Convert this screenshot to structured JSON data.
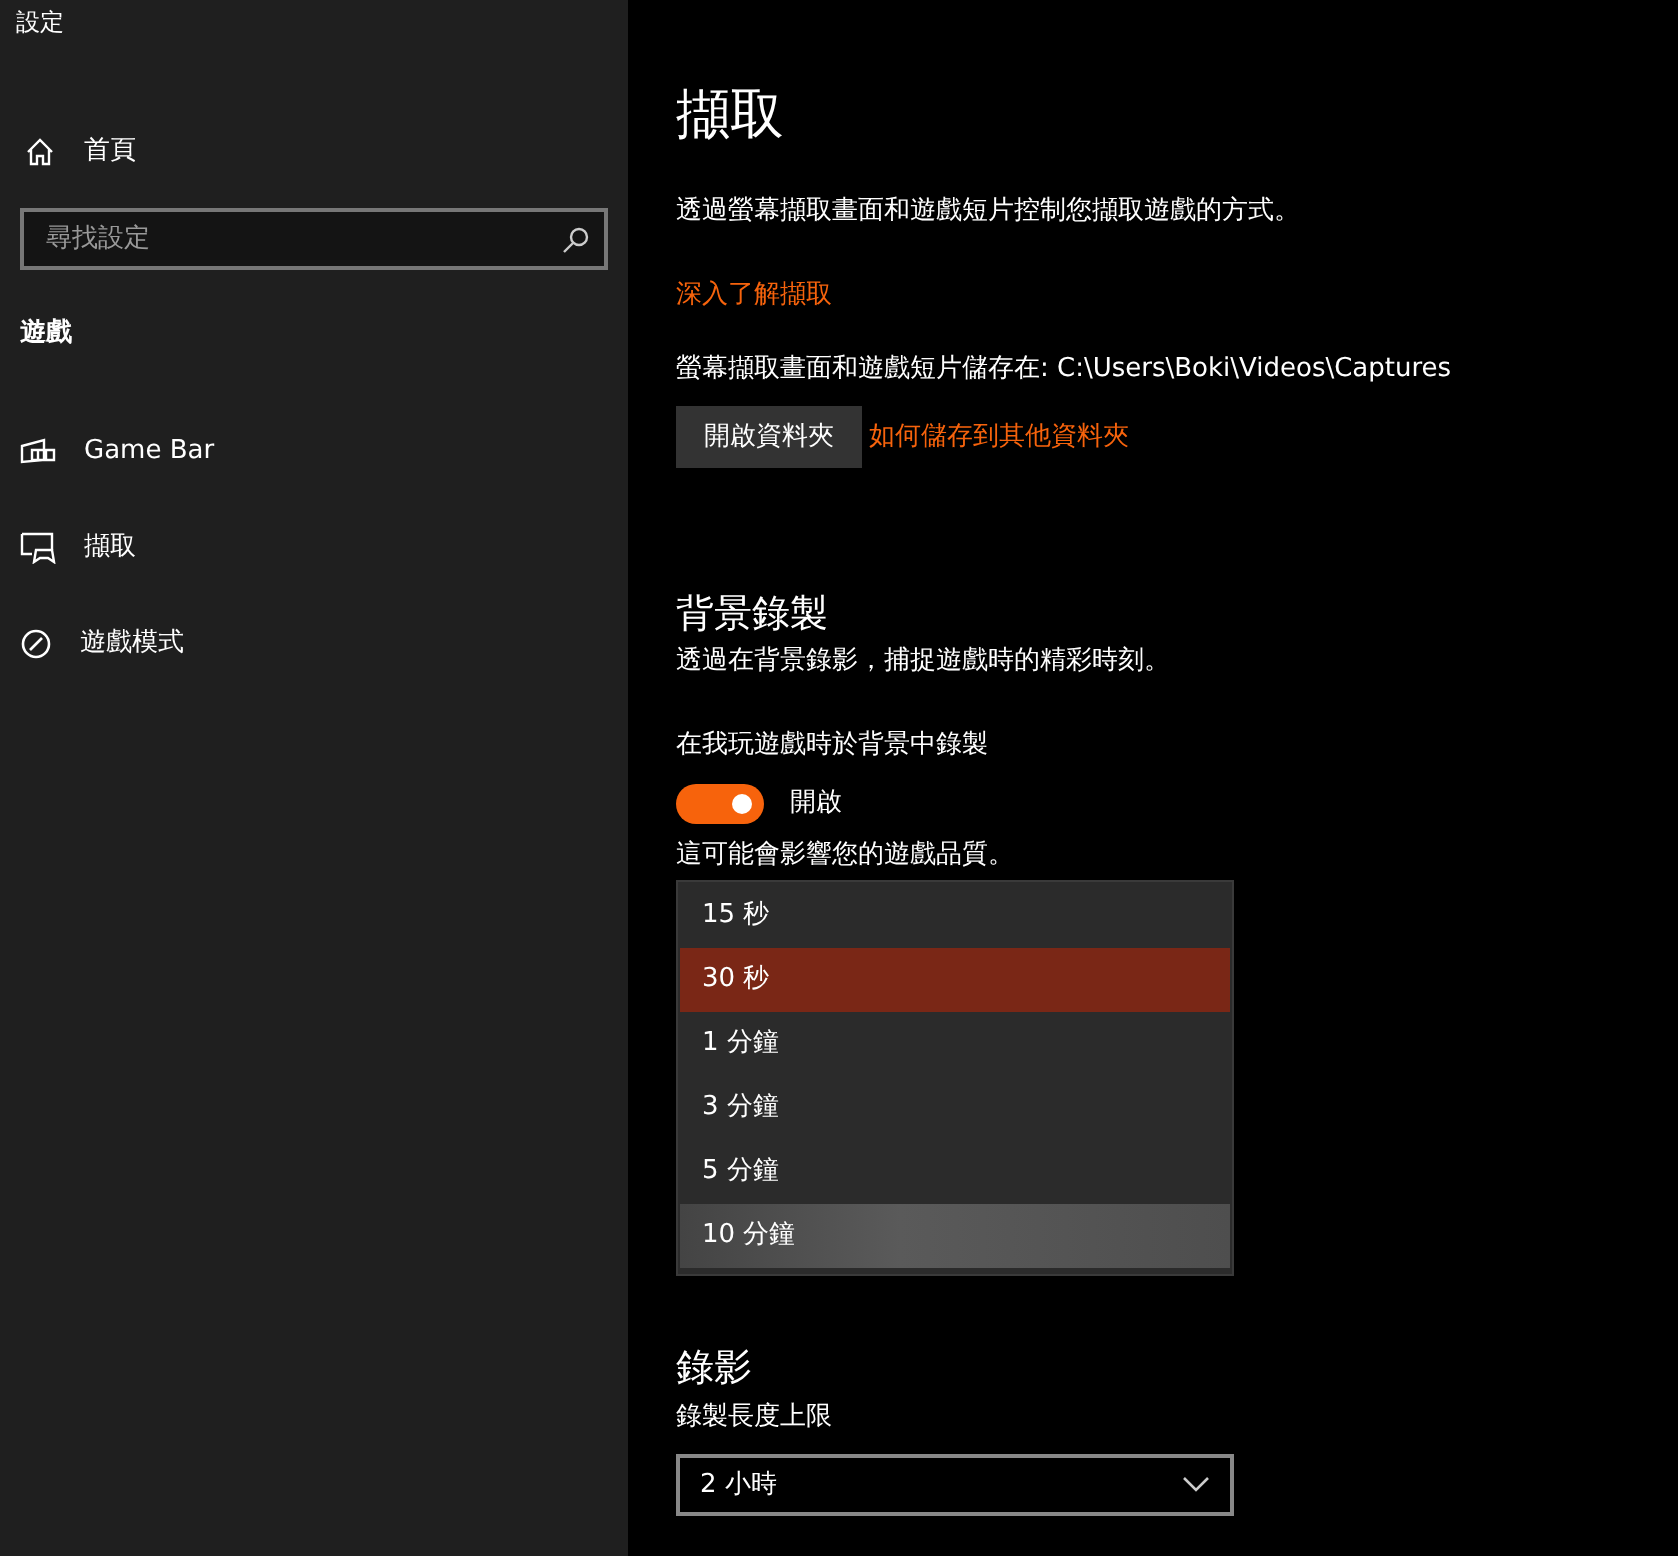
{
  "window": {
    "title": "設定"
  },
  "sidebar": {
    "home": "首頁",
    "search": {
      "placeholder": "尋找設定"
    },
    "section": "遊戲",
    "items": [
      {
        "label": "Game Bar",
        "kind": "gamebar"
      },
      {
        "label": "擷取",
        "kind": "capture"
      },
      {
        "label": "遊戲模式",
        "kind": "gamemode"
      }
    ]
  },
  "main": {
    "title": "擷取",
    "description": "透過螢幕擷取畫面和遊戲短片控制您擷取遊戲的方式。",
    "learn_more_link": "深入了解擷取",
    "save_path": "螢幕擷取畫面和遊戲短片儲存在: C:\\Users\\Boki\\Videos\\Captures",
    "open_folder_button": "開啟資料夾",
    "other_folder_link": "如何儲存到其他資料夾",
    "background_recording": {
      "heading": "背景錄製",
      "description": "透過在背景錄影，捕捉遊戲時的精彩時刻。",
      "toggle_label": "在我玩遊戲時於背景中錄製",
      "toggle": {
        "on": true,
        "state_text": "開啟"
      },
      "note": "這可能會影響您的遊戲品質。",
      "dropdown_options": [
        {
          "label": "15 秒",
          "selected": false,
          "hovered": false
        },
        {
          "label": "30 秒",
          "selected": true,
          "hovered": false
        },
        {
          "label": "1 分鐘",
          "selected": false,
          "hovered": false
        },
        {
          "label": "3 分鐘",
          "selected": false,
          "hovered": false
        },
        {
          "label": "5 分鐘",
          "selected": false,
          "hovered": false
        },
        {
          "label": "10 分鐘",
          "selected": false,
          "hovered": true
        }
      ]
    },
    "recording": {
      "heading": "錄影",
      "max_length_label": "錄製長度上限",
      "max_length_value": "2 小時"
    }
  }
}
